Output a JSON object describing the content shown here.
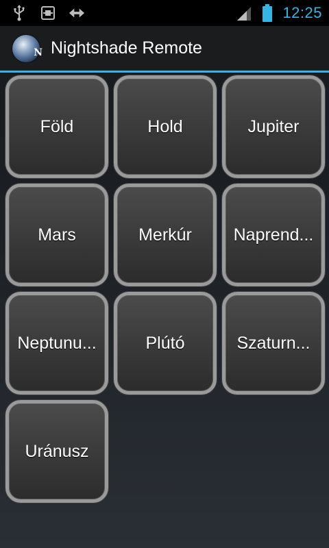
{
  "status_bar": {
    "icons_left": [
      "usb-icon",
      "debug-icon",
      "sync-icon"
    ],
    "icons_right": [
      "signal-icon",
      "battery-icon"
    ],
    "time": "12:25",
    "accent_color": "#33b5e5"
  },
  "action_bar": {
    "app_icon": "planet-logo-icon",
    "app_icon_letter": "N",
    "title": "Nightshade Remote"
  },
  "tiles": [
    {
      "label": "Föld"
    },
    {
      "label": "Hold"
    },
    {
      "label": "Jupiter"
    },
    {
      "label": "Mars"
    },
    {
      "label": "Merkúr"
    },
    {
      "label": "Naprend..."
    },
    {
      "label": "Neptunu..."
    },
    {
      "label": "Plútó"
    },
    {
      "label": "Szaturn..."
    },
    {
      "label": "Uránusz"
    }
  ]
}
